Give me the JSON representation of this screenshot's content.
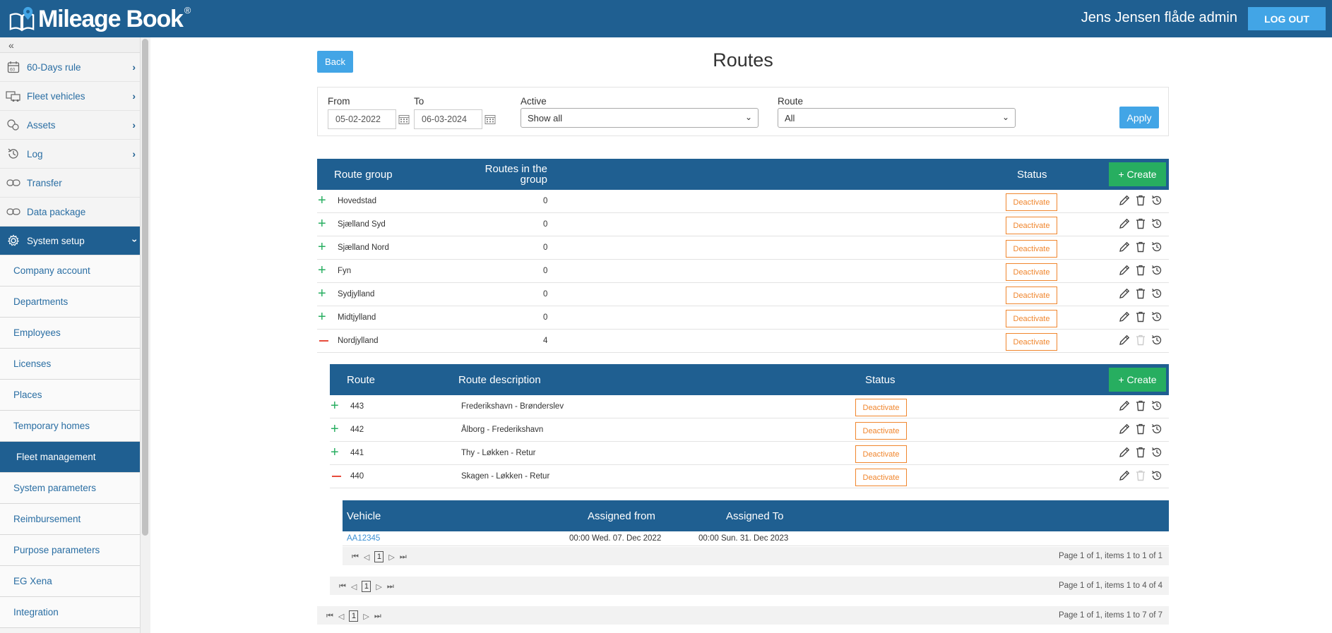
{
  "header": {
    "app_name": "Mileage Book",
    "reg_mark": "®",
    "user": "Jens Jensen flåde admin",
    "logout": "LOG OUT"
  },
  "sidebar": {
    "collapse": "«",
    "items": [
      {
        "label": "60-Days rule",
        "icon": "calendar-60-icon"
      },
      {
        "label": "Fleet vehicles",
        "icon": "fleet-vehicles-icon"
      },
      {
        "label": "Assets",
        "icon": "assets-icon"
      },
      {
        "label": "Log",
        "icon": "history-icon"
      },
      {
        "label": "Transfer",
        "icon": "transfer-icon"
      },
      {
        "label": "Data package",
        "icon": "data-package-icon"
      },
      {
        "label": "System setup",
        "icon": "gear-icon"
      }
    ],
    "sub_items": [
      "Company account",
      "Departments",
      "Employees",
      "Licenses",
      "Places",
      "Temporary homes",
      "Fleet management",
      "System parameters",
      "Reimbursement",
      "Purpose parameters",
      "EG Xena",
      "Integration"
    ]
  },
  "main": {
    "back": "Back",
    "title": "Routes",
    "filters": {
      "from_label": "From",
      "from_value": "05-02-2022",
      "to_label": "To",
      "to_value": "06-03-2024",
      "active_label": "Active",
      "active_value": "Show all",
      "route_label": "Route",
      "route_value": "All",
      "apply": "Apply"
    },
    "groups_table": {
      "headers": {
        "group": "Route group",
        "routes": "Routes in the group",
        "status": "Status",
        "create": "+ Create"
      },
      "rows": [
        {
          "name": "Hovedstad",
          "count": "0",
          "status": "Deactivate",
          "expanded": false
        },
        {
          "name": "Sjælland Syd",
          "count": "0",
          "status": "Deactivate",
          "expanded": false
        },
        {
          "name": "Sjælland Nord",
          "count": "0",
          "status": "Deactivate",
          "expanded": false
        },
        {
          "name": "Fyn",
          "count": "0",
          "status": "Deactivate",
          "expanded": false
        },
        {
          "name": "Sydjylland",
          "count": "0",
          "status": "Deactivate",
          "expanded": false
        },
        {
          "name": "Midtjylland",
          "count": "0",
          "status": "Deactivate",
          "expanded": false
        },
        {
          "name": "Nordjylland",
          "count": "4",
          "status": "Deactivate",
          "expanded": true
        }
      ],
      "pager": {
        "page": "1",
        "info": "Page 1 of 1, items 1 to 7 of 7"
      }
    },
    "routes_table": {
      "headers": {
        "route": "Route",
        "description": "Route description",
        "status": "Status",
        "create": "+ Create"
      },
      "rows": [
        {
          "route": "443",
          "description": "Frederikshavn - Brønderslev",
          "status": "Deactivate",
          "expanded": false
        },
        {
          "route": "442",
          "description": "Ålborg - Frederikshavn",
          "status": "Deactivate",
          "expanded": false
        },
        {
          "route": "441",
          "description": "Thy - Løkken - Retur",
          "status": "Deactivate",
          "expanded": false
        },
        {
          "route": "440",
          "description": "Skagen - Løkken - Retur",
          "status": "Deactivate",
          "expanded": true
        }
      ],
      "pager": {
        "page": "1",
        "info": "Page 1 of 1, items 1 to 4 of 4"
      }
    },
    "vehicles_table": {
      "headers": {
        "vehicle": "Vehicle",
        "from": "Assigned from",
        "to": "Assigned To"
      },
      "rows": [
        {
          "vehicle": "AA12345",
          "from": "00:00 Wed. 07. Dec 2022",
          "to": "00:00 Sun. 31. Dec 2023"
        }
      ],
      "pager": {
        "page": "1",
        "info": "Page 1 of 1, items 1 to 1 of 1"
      }
    }
  },
  "colors": {
    "header": "#1f5f91",
    "accent": "#42a5e6",
    "create": "#27ae60",
    "deactivate": "#f0862e"
  }
}
